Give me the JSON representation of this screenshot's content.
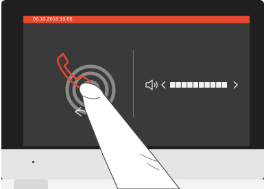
{
  "status_bar": {
    "datetime": "06.10.2018 19:08",
    "color": "#e5482f"
  },
  "screen": {
    "background": "#3a3a3a",
    "accent": "#e5482f"
  },
  "call_control": {
    "icon": "phone-handset-icon",
    "back_icon": "back-arrow-icon"
  },
  "volume": {
    "icon": "speaker-icon",
    "decrease_icon": "chevron-left-icon",
    "increase_icon": "chevron-right-icon",
    "level_segments": 10,
    "level_filled": 10
  }
}
